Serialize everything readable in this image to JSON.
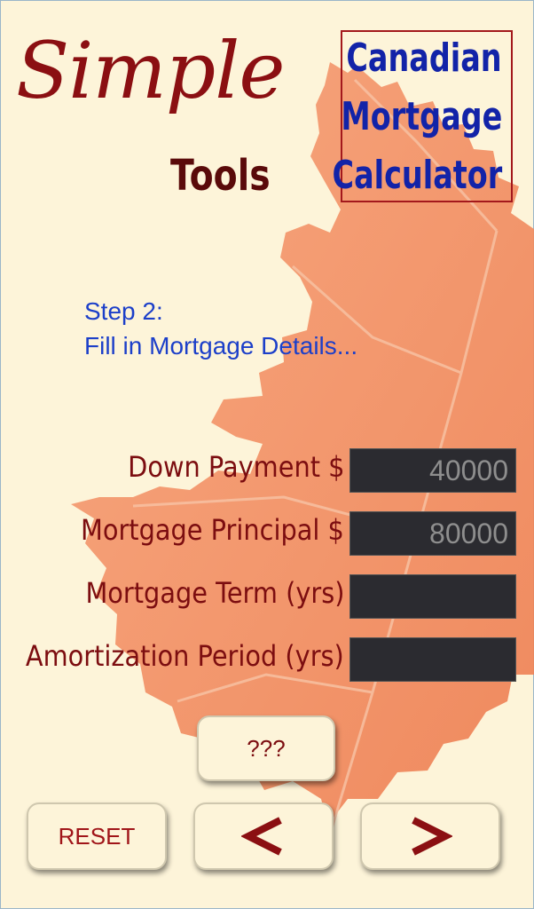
{
  "brand": {
    "simple": "Simple",
    "tools": "Tools"
  },
  "app_title": {
    "line1": "Canadian",
    "line2": "Mortgage",
    "line3": "Calculator"
  },
  "step": {
    "number": "Step 2:",
    "instruction": "Fill in Mortgage Details..."
  },
  "form": {
    "down_payment": {
      "label": "Down Payment $",
      "value": "",
      "placeholder": "40000"
    },
    "mortgage_principal": {
      "label": "Mortgage Principal $",
      "value": "",
      "placeholder": "80000"
    },
    "mortgage_term": {
      "label": "Mortgage Term (yrs)",
      "value": "",
      "placeholder": ""
    },
    "amortization_period": {
      "label": "Amortization Period (yrs)",
      "value": "",
      "placeholder": ""
    }
  },
  "buttons": {
    "help": "???",
    "reset": "RESET",
    "prev_icon": "chevron-left-icon",
    "next_icon": "chevron-right-icon"
  },
  "colors": {
    "background": "#fdf4d9",
    "brand": "#8b0f12",
    "title": "#1223a8",
    "step_text": "#1c3fc9",
    "field_bg": "#2b2b30",
    "leaf": "#f08a5c"
  }
}
